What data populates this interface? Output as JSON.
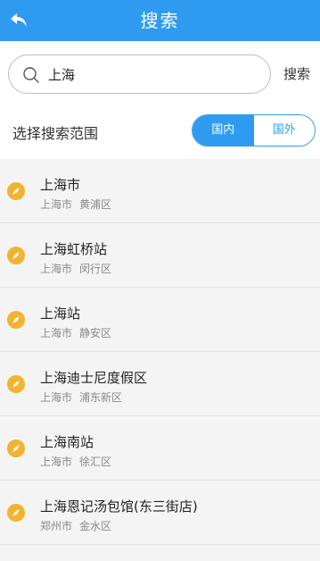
{
  "header": {
    "title": "搜索",
    "back_icon": "back-arrow-icon"
  },
  "search": {
    "value": "上海",
    "placeholder": "",
    "button_label": "搜索",
    "icon": "search-icon"
  },
  "scope": {
    "label": "选择搜索范围",
    "options": [
      {
        "label": "国内",
        "selected": true
      },
      {
        "label": "国外",
        "selected": false
      }
    ]
  },
  "colors": {
    "accent": "#2f9bf0",
    "pin": "#f0b431"
  },
  "results": [
    {
      "name": "上海市",
      "city": "上海市",
      "district": "黄浦区"
    },
    {
      "name": "上海虹桥站",
      "city": "上海市",
      "district": "闵行区"
    },
    {
      "name": "上海站",
      "city": "上海市",
      "district": "静安区"
    },
    {
      "name": "上海迪士尼度假区",
      "city": "上海市",
      "district": "浦东新区"
    },
    {
      "name": "上海南站",
      "city": "上海市",
      "district": "徐汇区"
    },
    {
      "name": "上海恩记汤包馆(东三街店)",
      "city": "郑州市",
      "district": "金水区"
    }
  ]
}
